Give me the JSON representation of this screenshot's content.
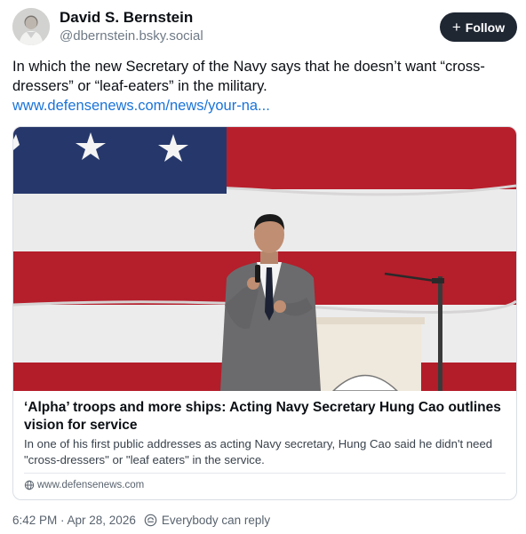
{
  "author": {
    "display_name": "David S. Bernstein",
    "handle": "@dbernstein.bsky.social",
    "follow_label": "Follow",
    "follow_icon": "+"
  },
  "post": {
    "text": "In which the new Secretary of the Navy says that he doesn’t want “cross-dressers” or “leaf-eaters” in the military.",
    "link_text": "www.defensenews.com/news/your-na..."
  },
  "link_card": {
    "image_subject": "man speaking at a microphone in front of a large American flag, podium and mic stand beside him",
    "title": "‘Alpha’ troops and more ships: Acting Navy Secretary Hung Cao outlines vision for service",
    "description": "In one of his first public addresses as acting Navy secretary, Hung Cao said he didn't need \"cross-dressers\" or \"leaf eaters\" in the service.",
    "domain": "www.defensenews.com",
    "domain_icon": "globe-icon"
  },
  "footer": {
    "timestamp": "6:42 PM · Apr 28, 2026",
    "reply_setting": "Everybody can reply",
    "reply_icon": "reply-settings-icon"
  },
  "colors": {
    "follow_button_bg": "#1f2733",
    "link": "#1a73d8",
    "flag_red": "#b81f2c",
    "flag_blue": "#26386b"
  }
}
